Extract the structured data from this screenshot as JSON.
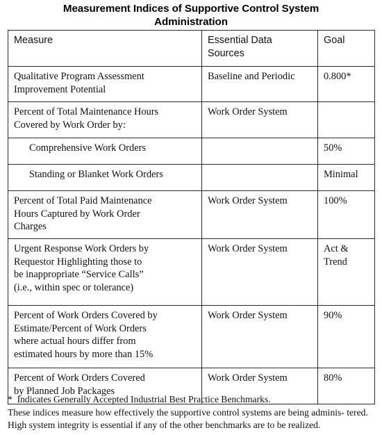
{
  "title": {
    "line1": "Measurement Indices of Supportive Control System",
    "line2": "Administration"
  },
  "table": {
    "columns": [
      {
        "key": "measure",
        "header": "Measure"
      },
      {
        "key": "source",
        "header": "Essential Data\nSources"
      },
      {
        "key": "goal",
        "header": "Goal"
      }
    ],
    "headers": {
      "measure": "Measure",
      "source_line1": "Essential Data",
      "source_line2": "Sources",
      "goal": "Goal"
    },
    "rows": [
      {
        "measure_line1": "Qualitative Program Assessment",
        "measure_line2": "Improvement Potential",
        "source": "Baseline and Periodic",
        "goal": "0.800*",
        "indent": false
      },
      {
        "measure_line1": "Percent of Total Maintenance Hours",
        "measure_line2": "Covered by Work Order by:",
        "source": "Work Order System",
        "goal": "",
        "indent": false
      },
      {
        "measure_line1": "Comprehensive Work Orders",
        "measure_line2": "",
        "source": "",
        "goal": "50%",
        "indent": true
      },
      {
        "measure_line1": "Standing or Blanket Work Orders",
        "measure_line2": "",
        "source": "",
        "goal": "Minimal",
        "indent": true
      },
      {
        "measure_line1": "Percent of Total Paid Maintenance",
        "measure_line2": "Hours Captured by Work Order",
        "measure_line3": "Charges",
        "source": "Work Order System",
        "goal": "100%",
        "indent": false
      },
      {
        "measure_line1": "Urgent Response Work Orders by",
        "measure_line2": "Requestor  Highlighting those to",
        "measure_line3": "be inappropriate “Service Calls”",
        "measure_line4": "(i.e., within spec or tolerance)",
        "source": "Work Order System",
        "goal_line1": "Act &",
        "goal_line2": "Trend",
        "indent": false
      },
      {
        "measure_line1": "Percent of Work Orders Covered by",
        "measure_line2": "Estimate/Percent of Work Orders",
        "measure_line3": "where actual hours differ from",
        "measure_line4": "estimated hours by more than 15%",
        "source": "Work Order System",
        "goal": "90%",
        "indent": false
      },
      {
        "measure_line1": "Percent of Work Orders Covered",
        "measure_line2": "by Planned Job Packages",
        "source": "Work Order System",
        "goal": "80%",
        "indent": false
      }
    ]
  },
  "footnotes": {
    "star_note": "*  Indicates Generally Accepted Industrial Best Practice Benchmarks.",
    "body_line1": "These indices measure how effectively the supportive control systems are being adminis-",
    "body_line2": "tered. High system integrity is essential if any of the other benchmarks are to be realized."
  }
}
